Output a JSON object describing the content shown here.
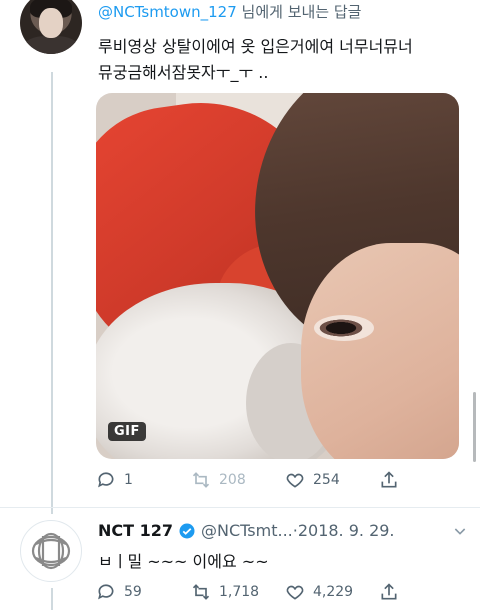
{
  "reply_tweet": {
    "reply_to_handle": "@NCTsmtown_127",
    "reply_to_suffix": " 님에게 보내는 답글",
    "text": "루비영상 상탈이에여 옷 입은거에여 너무너뮤너\n뮤궁금해서잠못자ㅜ_ㅜ ..",
    "media": {
      "badge": "GIF"
    },
    "actions": {
      "reply": "1",
      "retweet": "208",
      "like": "254"
    }
  },
  "main_tweet": {
    "display_name": "NCT 127",
    "handle": "@NCTsmt...",
    "separator": " · ",
    "date": "2018. 9. 29.",
    "text": "ㅂㅣ밀 ~~~ 이에요 ~~",
    "actions": {
      "reply": "59",
      "retweet": "1,718",
      "like": "4,229"
    }
  },
  "icons": {
    "reply": "comment-bubble-icon",
    "retweet": "retweet-arrows-icon",
    "like": "heart-icon",
    "share": "share-upload-icon",
    "verified": "verified-badge-icon",
    "more": "chevron-down-icon"
  },
  "colors": {
    "accent": "#1d9bf0",
    "secondary_text": "#536471",
    "disabled": "#aab8c2"
  }
}
